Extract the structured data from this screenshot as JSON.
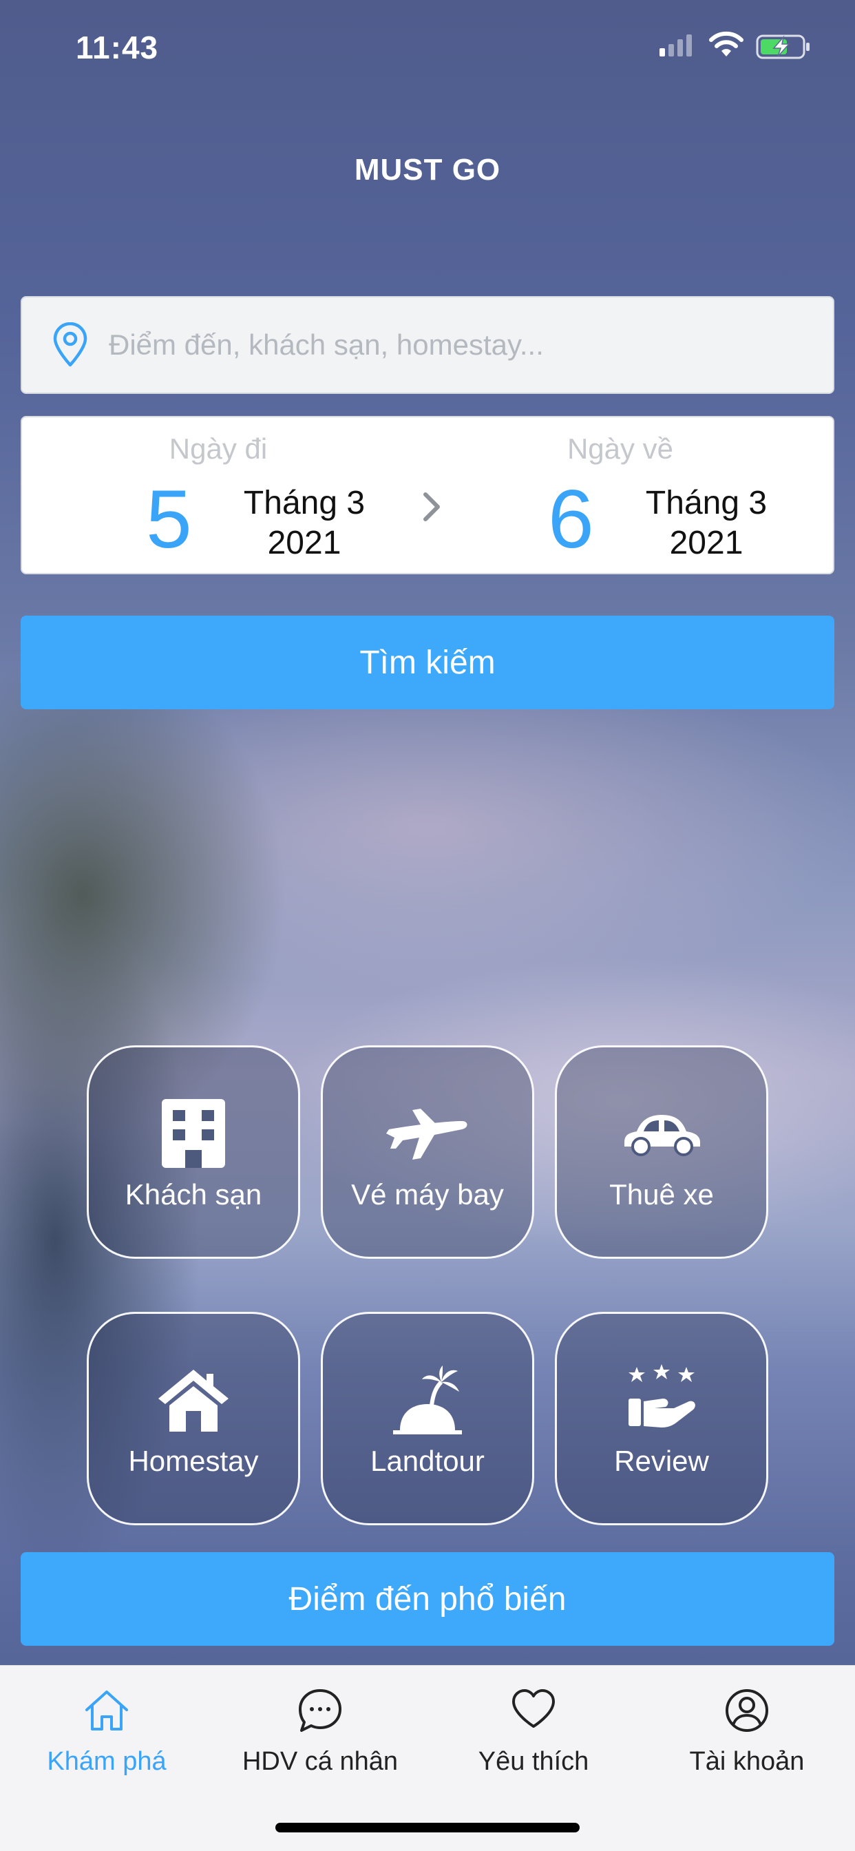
{
  "status_bar": {
    "time": "11:43"
  },
  "app": {
    "title": "MUST GO",
    "accent_color": "#3ea8fb"
  },
  "search": {
    "placeholder": "Điểm đến, khách sạn, homestay...",
    "icon": "location-pin-icon"
  },
  "dates": {
    "depart": {
      "label": "Ngày đi",
      "day": "5",
      "month": "Tháng 3",
      "year": "2021"
    },
    "return": {
      "label": "Ngày về",
      "day": "6",
      "month": "Tháng 3",
      "year": "2021"
    }
  },
  "buttons": {
    "search": "Tìm kiếm",
    "popular": "Điểm đến phổ biến"
  },
  "categories": [
    {
      "label": "Khách sạn",
      "icon": "building-icon"
    },
    {
      "label": "Vé máy bay",
      "icon": "airplane-icon"
    },
    {
      "label": "Thuê xe",
      "icon": "car-icon"
    },
    {
      "label": "Homestay",
      "icon": "house-icon"
    },
    {
      "label": "Landtour",
      "icon": "island-icon"
    },
    {
      "label": "Review",
      "icon": "stars-hand-icon"
    }
  ],
  "tabs": [
    {
      "label": "Khám phá",
      "icon": "home-icon",
      "active": true
    },
    {
      "label": "HDV cá nhân",
      "icon": "chat-bubble-icon",
      "active": false
    },
    {
      "label": "Yêu thích",
      "icon": "heart-icon",
      "active": false
    },
    {
      "label": "Tài khoản",
      "icon": "user-circle-icon",
      "active": false
    }
  ]
}
